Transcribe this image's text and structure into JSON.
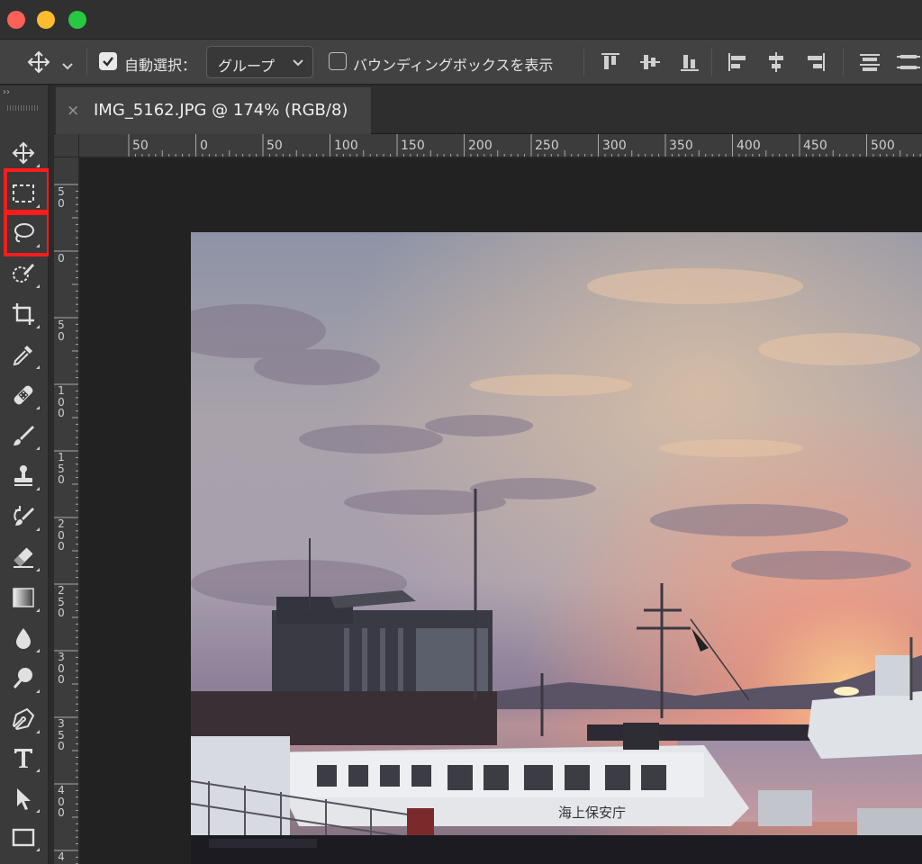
{
  "window": {
    "traffic_lights": {
      "close_color": "#fe5f57",
      "minimize_color": "#febc2e",
      "zoom_color": "#28c840"
    }
  },
  "options_bar": {
    "move_tool_icon": "move-arrows-icon",
    "auto_select_checked": true,
    "auto_select_label": "自動選択：",
    "auto_select_target": "グループ",
    "show_bounding_box_checked": false,
    "show_bounding_box_label": "バウンディングボックスを表示",
    "align_icons": [
      "align-top-edges-icon",
      "align-vertical-centers-icon",
      "align-bottom-edges-icon",
      "align-left-edges-icon",
      "align-horizontal-centers-icon",
      "align-right-edges-icon",
      "distribute-top-icon",
      "distribute-vertical-centers-icon"
    ]
  },
  "tools_panel": {
    "collapse_glyph": "››",
    "highlight_color": "#ff1c1c",
    "highlighted_tools": [
      "rectangular-marquee-tool",
      "lasso-tool"
    ],
    "tools": [
      "move-tool",
      "rectangular-marquee-tool",
      "lasso-tool",
      "quick-selection-tool",
      "crop-tool",
      "eyedropper-tool",
      "spot-healing-brush-tool",
      "brush-tool",
      "clone-stamp-tool",
      "history-brush-tool",
      "eraser-tool",
      "gradient-tool",
      "blur-tool",
      "dodge-tool",
      "pen-tool",
      "type-tool",
      "path-selection-tool",
      "rectangle-tool"
    ]
  },
  "document_tab": {
    "close_glyph": "×",
    "title": "IMG_5162.JPG @ 174% (RGB/8)"
  },
  "ruler_top": [
    "50",
    "0",
    "50",
    "100",
    "150",
    "200",
    "250",
    "300",
    "350",
    "400",
    "450",
    "500"
  ],
  "ruler_left": [
    "50",
    "0",
    "50",
    "100",
    "150",
    "200",
    "250",
    "300",
    "350",
    "400",
    "4"
  ],
  "photo": {
    "description_icon": "harbor-sunset-photo",
    "ship_text": "海上保安庁"
  }
}
